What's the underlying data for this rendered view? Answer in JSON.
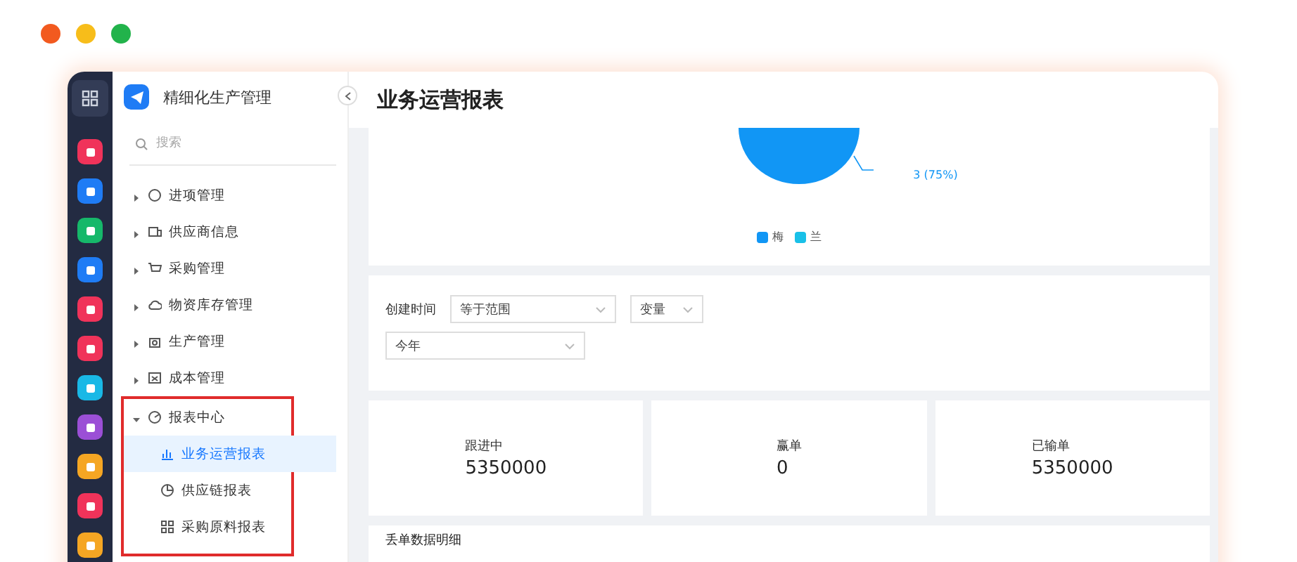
{
  "rail": {
    "icons": [
      {
        "color": "#f0335a"
      },
      {
        "color": "#1f7cf5"
      },
      {
        "color": "#16b86a"
      },
      {
        "color": "#1f7cf5"
      },
      {
        "color": "#f0335a"
      },
      {
        "color": "#f0335a"
      },
      {
        "color": "#19b8e6"
      },
      {
        "color": "#9b4fd6"
      },
      {
        "color": "#f5a623"
      },
      {
        "color": "#f0335a"
      },
      {
        "color": "#f5a623"
      }
    ]
  },
  "sidebar": {
    "app_name": "精细化生产管理",
    "search": {
      "placeholder": "搜索"
    },
    "items": [
      {
        "label": "进项管理",
        "expanded": false,
        "highlighted": false
      },
      {
        "label": "供应商信息",
        "expanded": false,
        "highlighted": false
      },
      {
        "label": "采购管理",
        "expanded": false,
        "highlighted": false
      },
      {
        "label": "物资库存管理",
        "expanded": false,
        "highlighted": false
      },
      {
        "label": "生产管理",
        "expanded": false,
        "highlighted": false
      },
      {
        "label": "成本管理",
        "expanded": false,
        "highlighted": false
      },
      {
        "label": "报表中心",
        "expanded": true,
        "highlighted": true,
        "children": [
          {
            "label": "业务运营报表",
            "selected": true
          },
          {
            "label": "供应链报表",
            "selected": false
          },
          {
            "label": "采购原料报表",
            "selected": false
          }
        ]
      }
    ]
  },
  "page": {
    "title": "业务运营报表",
    "pie": {
      "slice_label": "3 (75%)",
      "legend": [
        {
          "label": "梅",
          "color": "#1196f5"
        },
        {
          "label": "兰",
          "color": "#19c0e8"
        }
      ]
    },
    "filter": {
      "label": "创建时间",
      "operator": "等于范围",
      "mode": "变量",
      "value": "今年"
    },
    "stats": [
      {
        "label": "跟进中",
        "value": "5350000"
      },
      {
        "label": "赢单",
        "value": "0"
      },
      {
        "label": "已输单",
        "value": "5350000"
      }
    ],
    "detail_title": "丢单数据明细"
  }
}
